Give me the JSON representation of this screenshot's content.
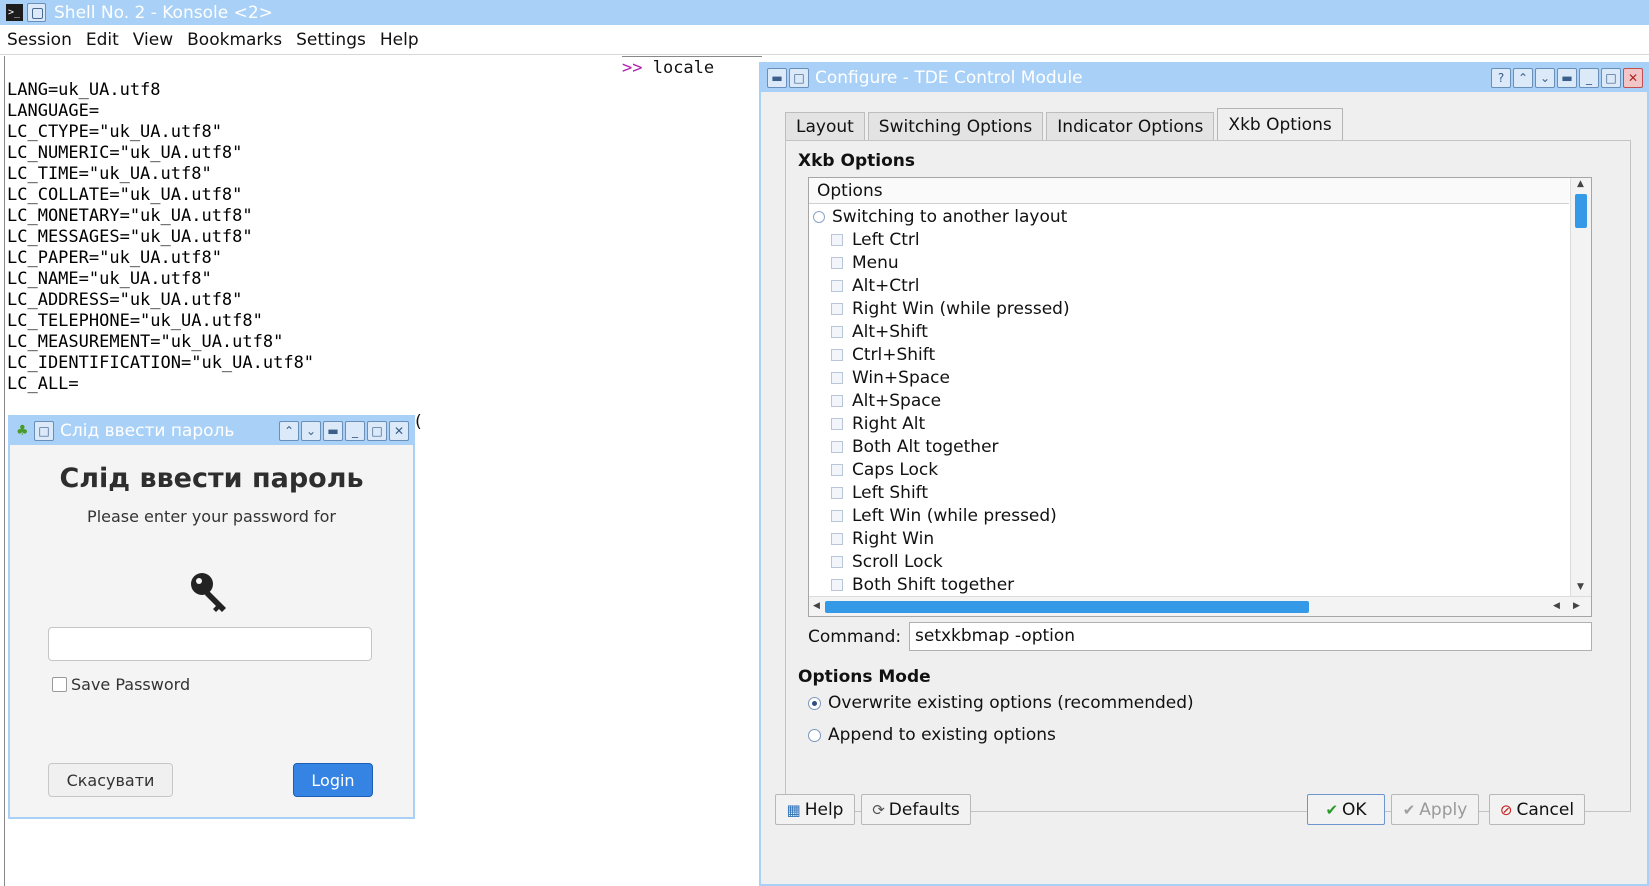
{
  "konsole": {
    "title": "Shell No. 2 - Konsole <2>",
    "menu": [
      "Session",
      "Edit",
      "View",
      "Bookmarks",
      "Settings",
      "Help"
    ]
  },
  "terminal": {
    "prompt_symbol": ">>",
    "prompt_command": " locale",
    "lines": [
      "LANG=uk_UA.utf8",
      "LANGUAGE=",
      "LC_CTYPE=\"uk_UA.utf8\"",
      "LC_NUMERIC=\"uk_UA.utf8\"",
      "LC_TIME=\"uk_UA.utf8\"",
      "LC_COLLATE=\"uk_UA.utf8\"",
      "LC_MONETARY=\"uk_UA.utf8\"",
      "LC_MESSAGES=\"uk_UA.utf8\"",
      "LC_PAPER=\"uk_UA.utf8\"",
      "LC_NAME=\"uk_UA.utf8\"",
      "LC_ADDRESS=\"uk_UA.utf8\"",
      "LC_TELEPHONE=\"uk_UA.utf8\"",
      "LC_MEASUREMENT=\"uk_UA.utf8\"",
      "LC_IDENTIFICATION=\"uk_UA.utf8\"",
      "LC_ALL="
    ],
    "stub": "("
  },
  "password_dialog": {
    "title": "Слід ввести пароль",
    "heading": "Слід ввести пароль",
    "subtitle": "Please enter your password for",
    "input_value": "",
    "save_password_label": "Save Password",
    "cancel_label": "Скасувати",
    "login_label": "Login"
  },
  "tde_dialog": {
    "title": "Configure - TDE Control Module",
    "tabs": [
      "Layout",
      "Switching Options",
      "Indicator Options",
      "Xkb Options"
    ],
    "active_tab": "Xkb Options",
    "group_title": "Xkb Options",
    "options_header": "Options",
    "parent_option": "Switching to another layout",
    "options": [
      "Left Ctrl",
      "Menu",
      "Alt+Ctrl",
      "Right Win (while pressed)",
      "Alt+Shift",
      "Ctrl+Shift",
      "Win+Space",
      "Alt+Space",
      "Right Alt",
      "Both Alt together",
      "Caps Lock",
      "Left Shift",
      "Left Win (while pressed)",
      "Right Win",
      "Scroll Lock",
      "Both Shift together"
    ],
    "command_label": "Command:",
    "command_value": "setxkbmap -option",
    "mode_title": "Options Mode",
    "mode_overwrite": "Overwrite existing options (recommended)",
    "mode_append": "Append to existing options",
    "buttons": {
      "help": "Help",
      "defaults": "Defaults",
      "ok": "OK",
      "apply": "Apply",
      "cancel": "Cancel"
    }
  },
  "colors": {
    "titlebar": "#a9d1f7",
    "accent_blue": "#3499e6",
    "login_blue": "#3584e4",
    "prompt_magenta": "#b01eb0"
  }
}
